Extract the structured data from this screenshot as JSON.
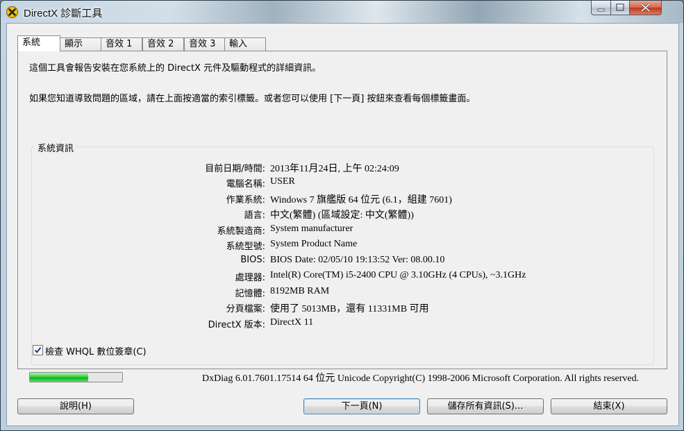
{
  "window": {
    "title": "DirectX 診斷工具"
  },
  "tabs": [
    {
      "label": "系統",
      "selected": true
    },
    {
      "label": "顯示",
      "selected": false
    },
    {
      "label": "音效 1",
      "selected": false
    },
    {
      "label": "音效 2",
      "selected": false
    },
    {
      "label": "音效 3",
      "selected": false
    },
    {
      "label": "輸入",
      "selected": false
    }
  ],
  "intro": {
    "line1": "這個工具會報告安裝在您系統上的 DirectX 元件及驅動程式的詳細資訊。",
    "line2": "如果您知道導致問題的區域，請在上面按適當的索引標籤。或者您可以使用 [下一頁] 按鈕來查看每個標籤畫面。"
  },
  "system_info": {
    "group_title": "系統資訊",
    "rows": [
      {
        "label": "目前日期/時間:",
        "value": "2013年11月24日, 上午 02:24:09"
      },
      {
        "label": "電腦名稱:",
        "value": "USER"
      },
      {
        "label": "作業系統:",
        "value": "Windows 7 旗艦版 64 位元 (6.1，組建 7601)"
      },
      {
        "label": "語言:",
        "value": "中文(繁體) (區域設定: 中文(繁體))"
      },
      {
        "label": "系統製造商:",
        "value": "System manufacturer"
      },
      {
        "label": "系統型號:",
        "value": "System Product Name"
      },
      {
        "label": "BIOS:",
        "value": "BIOS Date: 02/05/10 19:13:52 Ver: 08.00.10"
      },
      {
        "label": "處理器:",
        "value": "Intel(R) Core(TM) i5-2400 CPU @ 3.10GHz (4 CPUs), ~3.1GHz"
      },
      {
        "label": "記憶體:",
        "value": "8192MB RAM"
      },
      {
        "label": "分頁檔案:",
        "value": "使用了 5013MB，還有 11331MB 可用"
      },
      {
        "label": "DirectX 版本:",
        "value": "DirectX 11"
      }
    ]
  },
  "whql_check": {
    "label": "檢查 WHQL 數位簽章(C)",
    "checked": true
  },
  "progress": {
    "fraction": 0.63
  },
  "copyright": "DxDiag 6.01.7601.17514 64 位元 Unicode  Copyright(C) 1998-2006 Microsoft Corporation.  All rights reserved.",
  "buttons": {
    "help": "說明(H)",
    "next": "下一頁(N)",
    "save_all": "儲存所有資訊(S)...",
    "exit": "結束(X)"
  },
  "colors": {
    "progress_green": "#06b025",
    "default_button_border": "#3c7fb1"
  },
  "icons": {
    "app": "directx-x-icon",
    "minimize": "minimize-icon",
    "maximize": "maximize-icon",
    "close": "close-icon",
    "checkbox": "checkmark-icon"
  }
}
